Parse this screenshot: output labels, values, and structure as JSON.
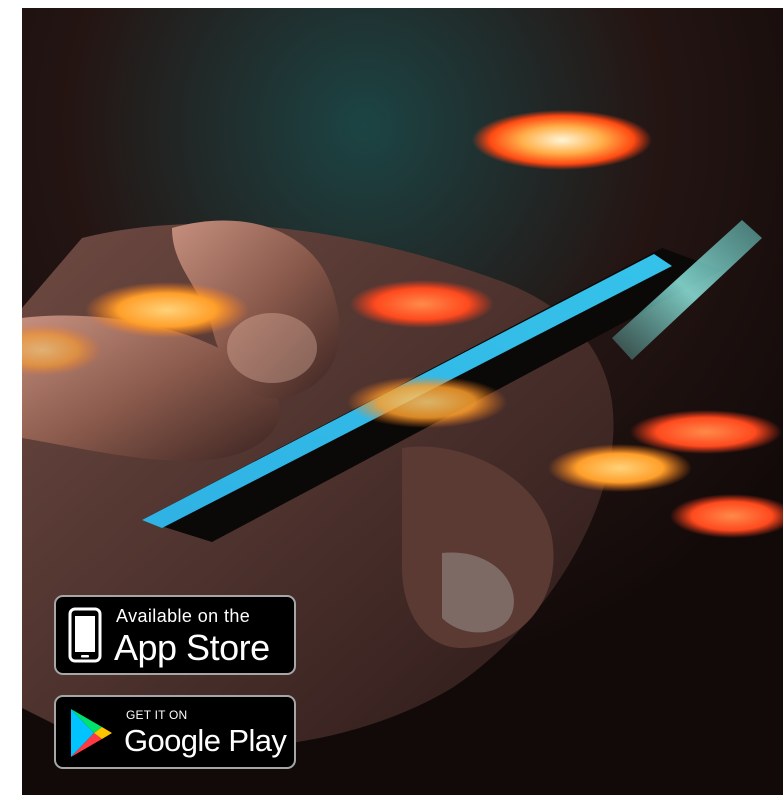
{
  "badges": {
    "app_store": {
      "small_text": "Available on the",
      "large_text": "App Store",
      "icon": "phone-icon"
    },
    "google_play": {
      "small_text": "GET IT ON",
      "large_text": "Google Play",
      "icon": "play-triangle-icon"
    }
  },
  "colors": {
    "badge_bg": "#000000",
    "badge_border": "#a6a6a6",
    "badge_text": "#ffffff",
    "screen_glow": "#27a6d6",
    "light_orange": "#ff7a1a",
    "light_red": "#ff3a1a"
  }
}
